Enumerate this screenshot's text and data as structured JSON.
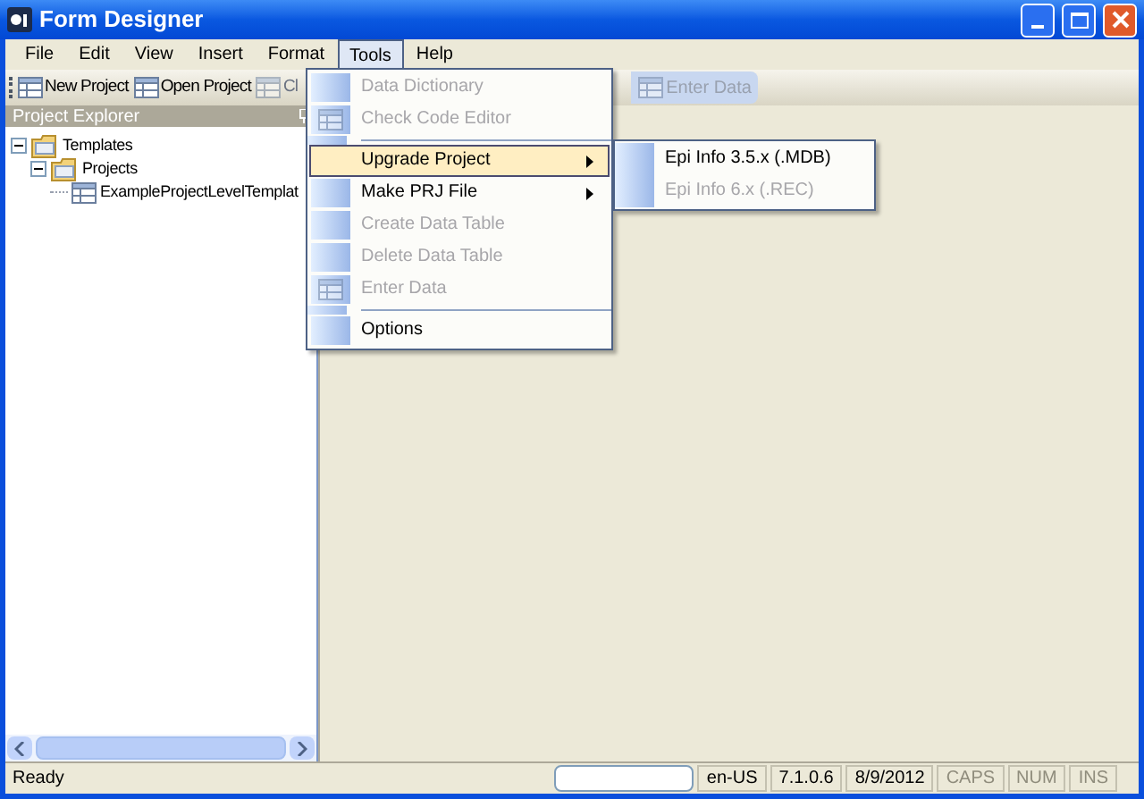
{
  "window": {
    "title": "Form Designer"
  },
  "menu_bar": [
    {
      "label": "File",
      "selected": false
    },
    {
      "label": "Edit",
      "selected": false
    },
    {
      "label": "View",
      "selected": false
    },
    {
      "label": "Insert",
      "selected": false
    },
    {
      "label": "Format",
      "selected": false
    },
    {
      "label": "Tools",
      "selected": true
    },
    {
      "label": "Help",
      "selected": false
    }
  ],
  "toolbar": [
    {
      "label": "New Project",
      "disabled": false
    },
    {
      "label": "Open Project",
      "disabled": false
    },
    {
      "label": "Cl",
      "disabled": true
    }
  ],
  "toolbar_right": [
    {
      "label": "Enter Data",
      "disabled": true
    }
  ],
  "project_explorer": {
    "title": "Project Explorer",
    "tree": [
      {
        "label": "Templates",
        "expanded": true,
        "children": [
          {
            "label": "Projects",
            "expanded": true,
            "children": [
              {
                "label": "ExampleProjectLevelTemplat",
                "kind": "table"
              }
            ]
          }
        ]
      }
    ]
  },
  "tools_menu": [
    {
      "kind": "item",
      "label": "Data Dictionary",
      "disabled": true,
      "selected": false,
      "submenu": false,
      "icon": false
    },
    {
      "kind": "item",
      "label": "Check Code Editor",
      "disabled": true,
      "selected": false,
      "submenu": false,
      "icon": true
    },
    {
      "kind": "separator"
    },
    {
      "kind": "item",
      "label": "Upgrade Project",
      "disabled": false,
      "selected": true,
      "submenu": true,
      "icon": false
    },
    {
      "kind": "item",
      "label": "Make PRJ File",
      "disabled": false,
      "selected": false,
      "submenu": true,
      "icon": false
    },
    {
      "kind": "item",
      "label": "Create Data Table",
      "disabled": true,
      "selected": false,
      "submenu": false,
      "icon": false
    },
    {
      "kind": "item",
      "label": "Delete Data Table",
      "disabled": true,
      "selected": false,
      "submenu": false,
      "icon": false
    },
    {
      "kind": "item",
      "label": "Enter Data",
      "disabled": true,
      "selected": false,
      "submenu": false,
      "icon": true
    },
    {
      "kind": "separator"
    },
    {
      "kind": "item",
      "label": "Options",
      "disabled": false,
      "selected": false,
      "submenu": false,
      "icon": false
    }
  ],
  "upgrade_submenu": [
    {
      "label": "Epi Info 3.5.x (.MDB)",
      "disabled": false
    },
    {
      "label": "Epi Info 6.x (.REC)",
      "disabled": true
    }
  ],
  "status_bar": {
    "message": "Ready",
    "panels": [
      {
        "kind": "field"
      },
      {
        "kind": "text",
        "label": "en-US",
        "disabled": false
      },
      {
        "kind": "text",
        "label": "7.1.0.6",
        "disabled": false
      },
      {
        "kind": "text",
        "label": "8/9/2012",
        "disabled": false
      },
      {
        "kind": "text",
        "label": "CAPS",
        "disabled": true
      },
      {
        "kind": "text",
        "label": "NUM",
        "disabled": true
      },
      {
        "kind": "text",
        "label": "INS",
        "disabled": true
      }
    ]
  }
}
